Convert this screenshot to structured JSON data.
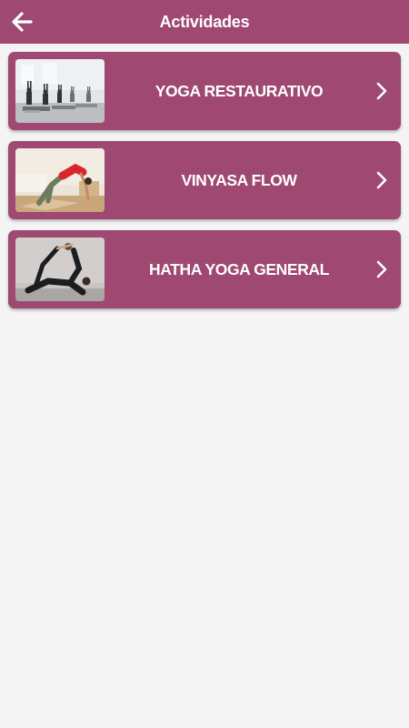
{
  "appbar": {
    "title": "Actividades",
    "back_icon": "arrow-left-icon"
  },
  "activities": [
    {
      "label": "YOGA RESTAURATIVO",
      "image": "yoga-class-photo",
      "icon": "chevron-right-icon"
    },
    {
      "label": "VINYASA FLOW",
      "image": "vinyasa-pose-photo",
      "icon": "chevron-right-icon"
    },
    {
      "label": "HATHA YOGA GENERAL",
      "image": "hatha-pose-photo",
      "icon": "chevron-right-icon"
    }
  ],
  "colors": {
    "primary": "#9e4872",
    "background": "#f4f4f4",
    "text_on_primary": "#ffffff"
  }
}
